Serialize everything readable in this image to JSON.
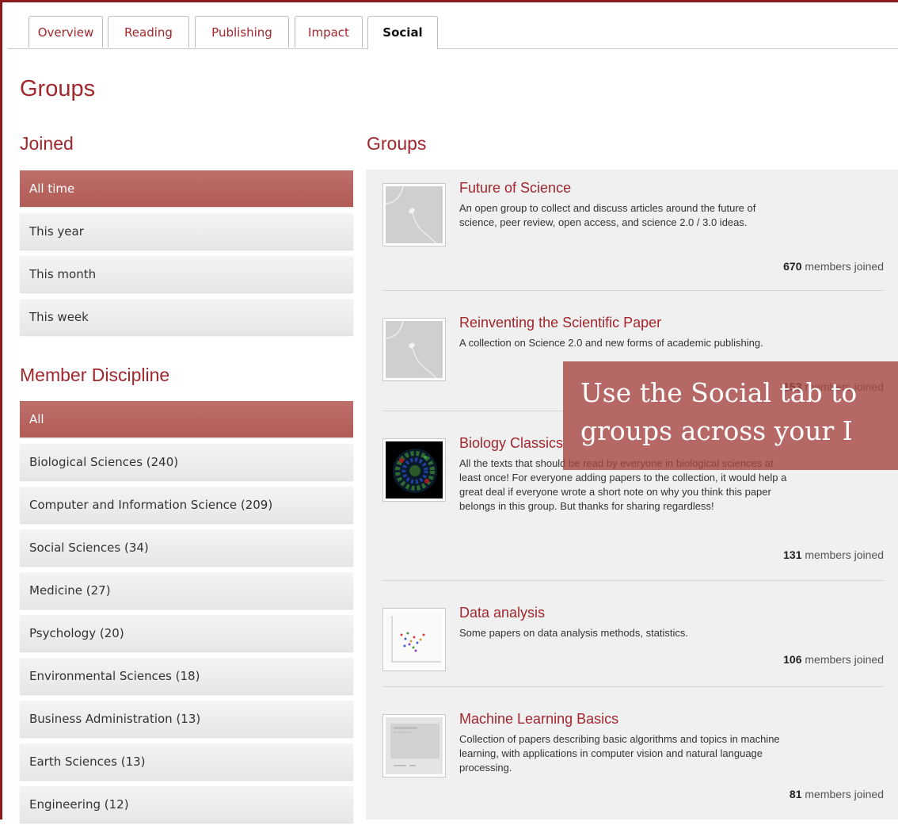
{
  "tabs": [
    {
      "label": "Overview"
    },
    {
      "label": "Reading"
    },
    {
      "label": "Publishing"
    },
    {
      "label": "Impact"
    },
    {
      "label": "Social",
      "active": true
    }
  ],
  "page_title": "Groups",
  "joined": {
    "heading": "Joined",
    "items": [
      "All time",
      "This year",
      "This month",
      "This week"
    ],
    "selected": "All time"
  },
  "discipline": {
    "heading": "Member Discipline",
    "items": [
      "All",
      "Biological Sciences (240)",
      "Computer and Information Science (209)",
      "Social Sciences (34)",
      "Medicine (27)",
      "Psychology (20)",
      "Environmental Sciences (18)",
      "Business Administration (13)",
      "Earth Sciences (13)",
      "Engineering (12)"
    ],
    "selected": "All"
  },
  "groups": {
    "heading": "Groups",
    "members_suffix": "members joined",
    "items": [
      {
        "name": "Future of Science",
        "description": "An open group to collect and discuss articles around the future of science, peer review, open access, and science 2.0 / 3.0 ideas.",
        "members": "670"
      },
      {
        "name": "Reinventing the Scientific Paper",
        "description": "A collection on Science 2.0 and new forms of academic publishing.",
        "members": "153"
      },
      {
        "name": "Biology Classics",
        "description": "All the texts that should be read by everyone in biological sciences at least once! For everyone adding papers to the collection, it would help a great deal if everyone wrote a short note on why you think this paper belongs in this group. But thanks for sharing regardless!",
        "members": "131"
      },
      {
        "name": "Data analysis",
        "description": "Some papers on data analysis methods, statistics.",
        "members": "106"
      },
      {
        "name": "Machine Learning Basics",
        "description": "Collection of papers describing basic algorithms and topics in machine learning, with applications in computer vision and natural language processing.",
        "members": "81"
      }
    ]
  },
  "overlay": {
    "line1": "Use the Social tab to",
    "line2": "groups across your I"
  },
  "colors": {
    "brand": "#a1272d",
    "selected": "#b5605b",
    "panel": "#f0f0f0"
  }
}
